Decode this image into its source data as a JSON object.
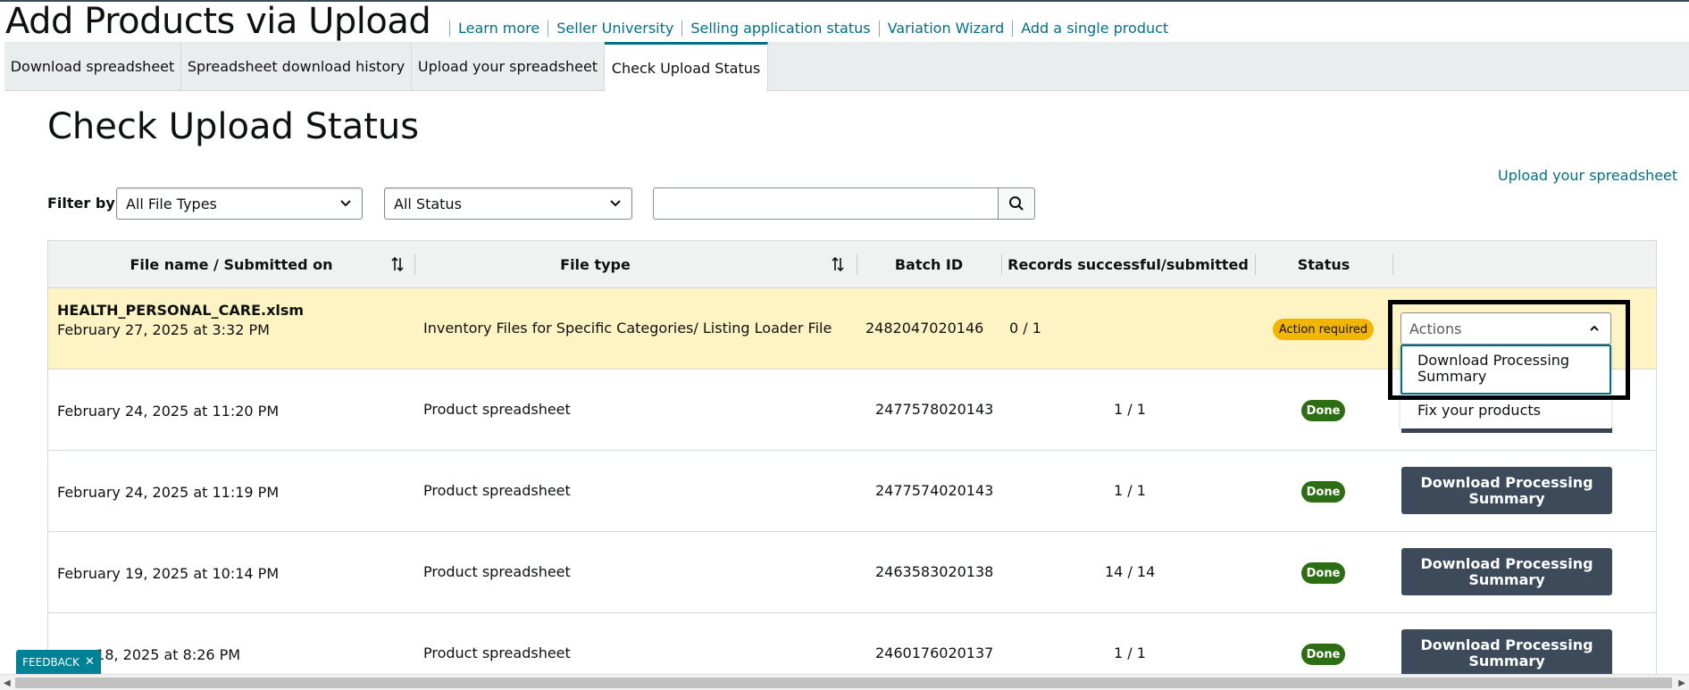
{
  "header": {
    "app_title": "Add Products via Upload",
    "links": [
      "Learn more",
      "Seller University",
      "Selling application status",
      "Variation Wizard",
      "Add a single product"
    ]
  },
  "tabs": [
    {
      "label": "Download spreadsheet"
    },
    {
      "label": "Spreadsheet download history"
    },
    {
      "label": "Upload your spreadsheet"
    },
    {
      "label": "Check Upload Status",
      "active": true
    }
  ],
  "page_title": "Check Upload Status",
  "upload_link": "Upload your spreadsheet",
  "filter": {
    "label": "Filter by:",
    "file_type": "All File Types",
    "status": "All Status",
    "search_value": ""
  },
  "table": {
    "columns": [
      "File name / Submitted on",
      "File type",
      "Batch ID",
      "Records successful/submitted",
      "Status"
    ],
    "rows": [
      {
        "file_name": "HEALTH_PERSONAL_CARE.xlsm",
        "submitted": "February 27, 2025 at 3:32 PM",
        "file_type": "Inventory Files for Specific Categories/ Listing Loader File",
        "batch_id": "2482047020146",
        "records": "0 / 1",
        "status": "Action required",
        "action": "Actions"
      },
      {
        "file_name": "",
        "submitted": "February 24, 2025 at 11:20 PM",
        "file_type": "Product spreadsheet",
        "batch_id": "2477578020143",
        "records": "1 / 1",
        "status": "Done",
        "action": ""
      },
      {
        "file_name": "",
        "submitted": "February 24, 2025 at 11:19 PM",
        "file_type": "Product spreadsheet",
        "batch_id": "2477574020143",
        "records": "1 / 1",
        "status": "Done",
        "action": "Download Processing Summary"
      },
      {
        "file_name": "",
        "submitted": "February 19, 2025 at 10:14 PM",
        "file_type": "Product spreadsheet",
        "batch_id": "2463583020138",
        "records": "14 / 14",
        "status": "Done",
        "action": "Download Processing Summary"
      },
      {
        "file_name": "",
        "submitted": "ry 18, 2025 at 8:26 PM",
        "file_type": "Product spreadsheet",
        "batch_id": "2460176020137",
        "records": "1 / 1",
        "status": "Done",
        "action": "Download Processing Summary"
      }
    ]
  },
  "actions_dropdown": {
    "items": [
      "Download Processing Summary",
      "Fix your products"
    ]
  },
  "feedback": "FEEDBACK",
  "colors": {
    "link": "#007185",
    "highlight_row": "#fef3c2",
    "done_badge": "#2d6e14",
    "warn_badge": "#f2b600",
    "dark_button": "#3d4a5a"
  }
}
